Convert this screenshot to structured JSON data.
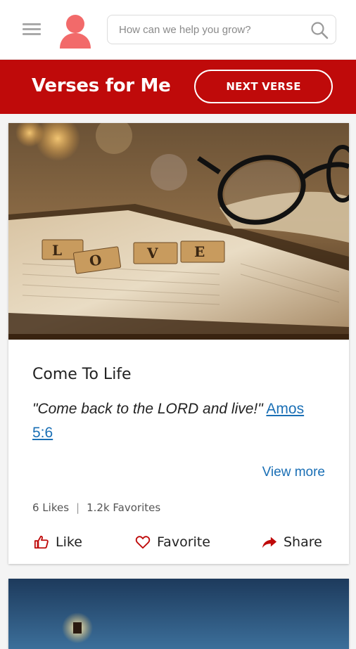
{
  "header": {
    "menu_icon": "hamburger-icon",
    "avatar_icon": "user-icon",
    "search": {
      "placeholder": "How can we help you grow?",
      "value": "",
      "icon": "search-icon"
    }
  },
  "banner": {
    "title": "Verses for Me",
    "next_button": "NEXT VERSE"
  },
  "card": {
    "title": "Come To Life",
    "quote": "\"Come back to the LORD and live!\"",
    "reference": "Amos 5:6",
    "view_more": "View more",
    "likes": "6 Likes",
    "favorites": "1.2k Favorites",
    "actions": {
      "like": "Like",
      "favorite": "Favorite",
      "share": "Share"
    }
  },
  "colors": {
    "brand_red": "#bf0a0a",
    "link_blue": "#1a6fb5",
    "avatar_pink": "#f26a6a"
  }
}
